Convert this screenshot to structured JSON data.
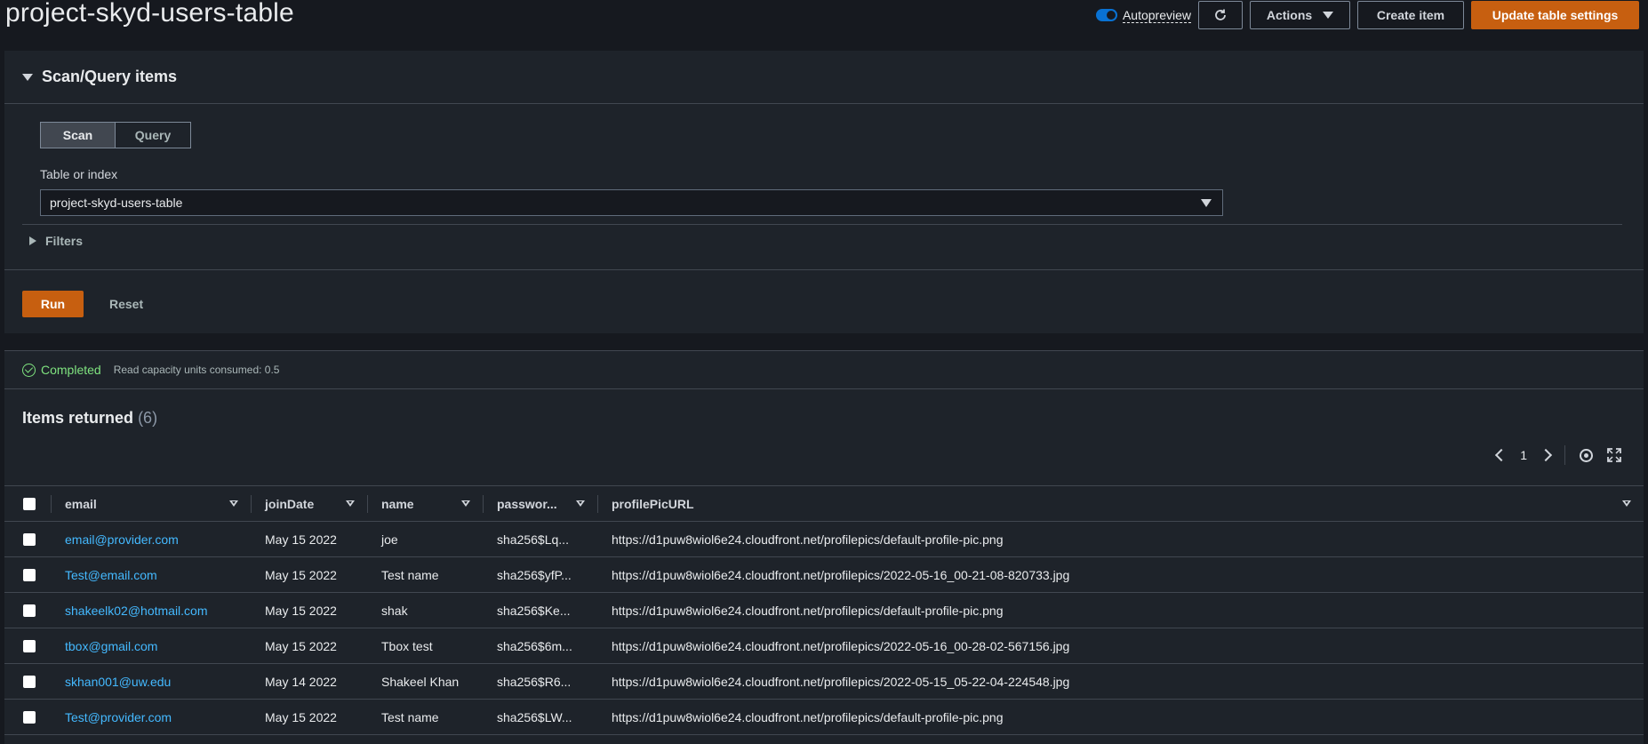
{
  "header": {
    "title": "project-skyd-users-table",
    "autopreview_label": "Autopreview",
    "actions_label": "Actions",
    "create_item_label": "Create item",
    "update_settings_label": "Update table settings"
  },
  "scan_query": {
    "section_title": "Scan/Query items",
    "tabs": [
      "Scan",
      "Query"
    ],
    "table_label": "Table or index",
    "table_value": "project-skyd-users-table",
    "filters_label": "Filters",
    "run_label": "Run",
    "reset_label": "Reset"
  },
  "status": {
    "text": "Completed",
    "rcu": "Read capacity units consumed: 0.5"
  },
  "items": {
    "title": "Items returned",
    "count": "(6)",
    "page": "1",
    "columns": [
      "email",
      "joinDate",
      "name",
      "passwor...",
      "profilePicURL"
    ],
    "rows": [
      {
        "email": "email@provider.com",
        "joinDate": "May 15 2022",
        "name": "joe",
        "password": "sha256$Lq...",
        "profilePicURL": "https://d1puw8wiol6e24.cloudfront.net/profilepics/default-profile-pic.png"
      },
      {
        "email": "Test@email.com",
        "joinDate": "May 15 2022",
        "name": "Test name",
        "password": "sha256$yfP...",
        "profilePicURL": "https://d1puw8wiol6e24.cloudfront.net/profilepics/2022-05-16_00-21-08-820733.jpg"
      },
      {
        "email": "shakeelk02@hotmail.com",
        "joinDate": "May 15 2022",
        "name": "shak",
        "password": "sha256$Ke...",
        "profilePicURL": "https://d1puw8wiol6e24.cloudfront.net/profilepics/default-profile-pic.png"
      },
      {
        "email": "tbox@gmail.com",
        "joinDate": "May 15 2022",
        "name": "Tbox test",
        "password": "sha256$6m...",
        "profilePicURL": "https://d1puw8wiol6e24.cloudfront.net/profilepics/2022-05-16_00-28-02-567156.jpg"
      },
      {
        "email": "skhan001@uw.edu",
        "joinDate": "May 14 2022",
        "name": "Shakeel Khan",
        "password": "sha256$R6...",
        "profilePicURL": "https://d1puw8wiol6e24.cloudfront.net/profilepics/2022-05-15_05-22-04-224548.jpg"
      },
      {
        "email": "Test@provider.com",
        "joinDate": "May 15 2022",
        "name": "Test name",
        "password": "sha256$LW...",
        "profilePicURL": "https://d1puw8wiol6e24.cloudfront.net/profilepics/default-profile-pic.png"
      }
    ]
  },
  "colors": {
    "primary": "#ec7211",
    "link": "#44b9ff",
    "success": "#7fe37f",
    "toggle": "#0972d3"
  }
}
